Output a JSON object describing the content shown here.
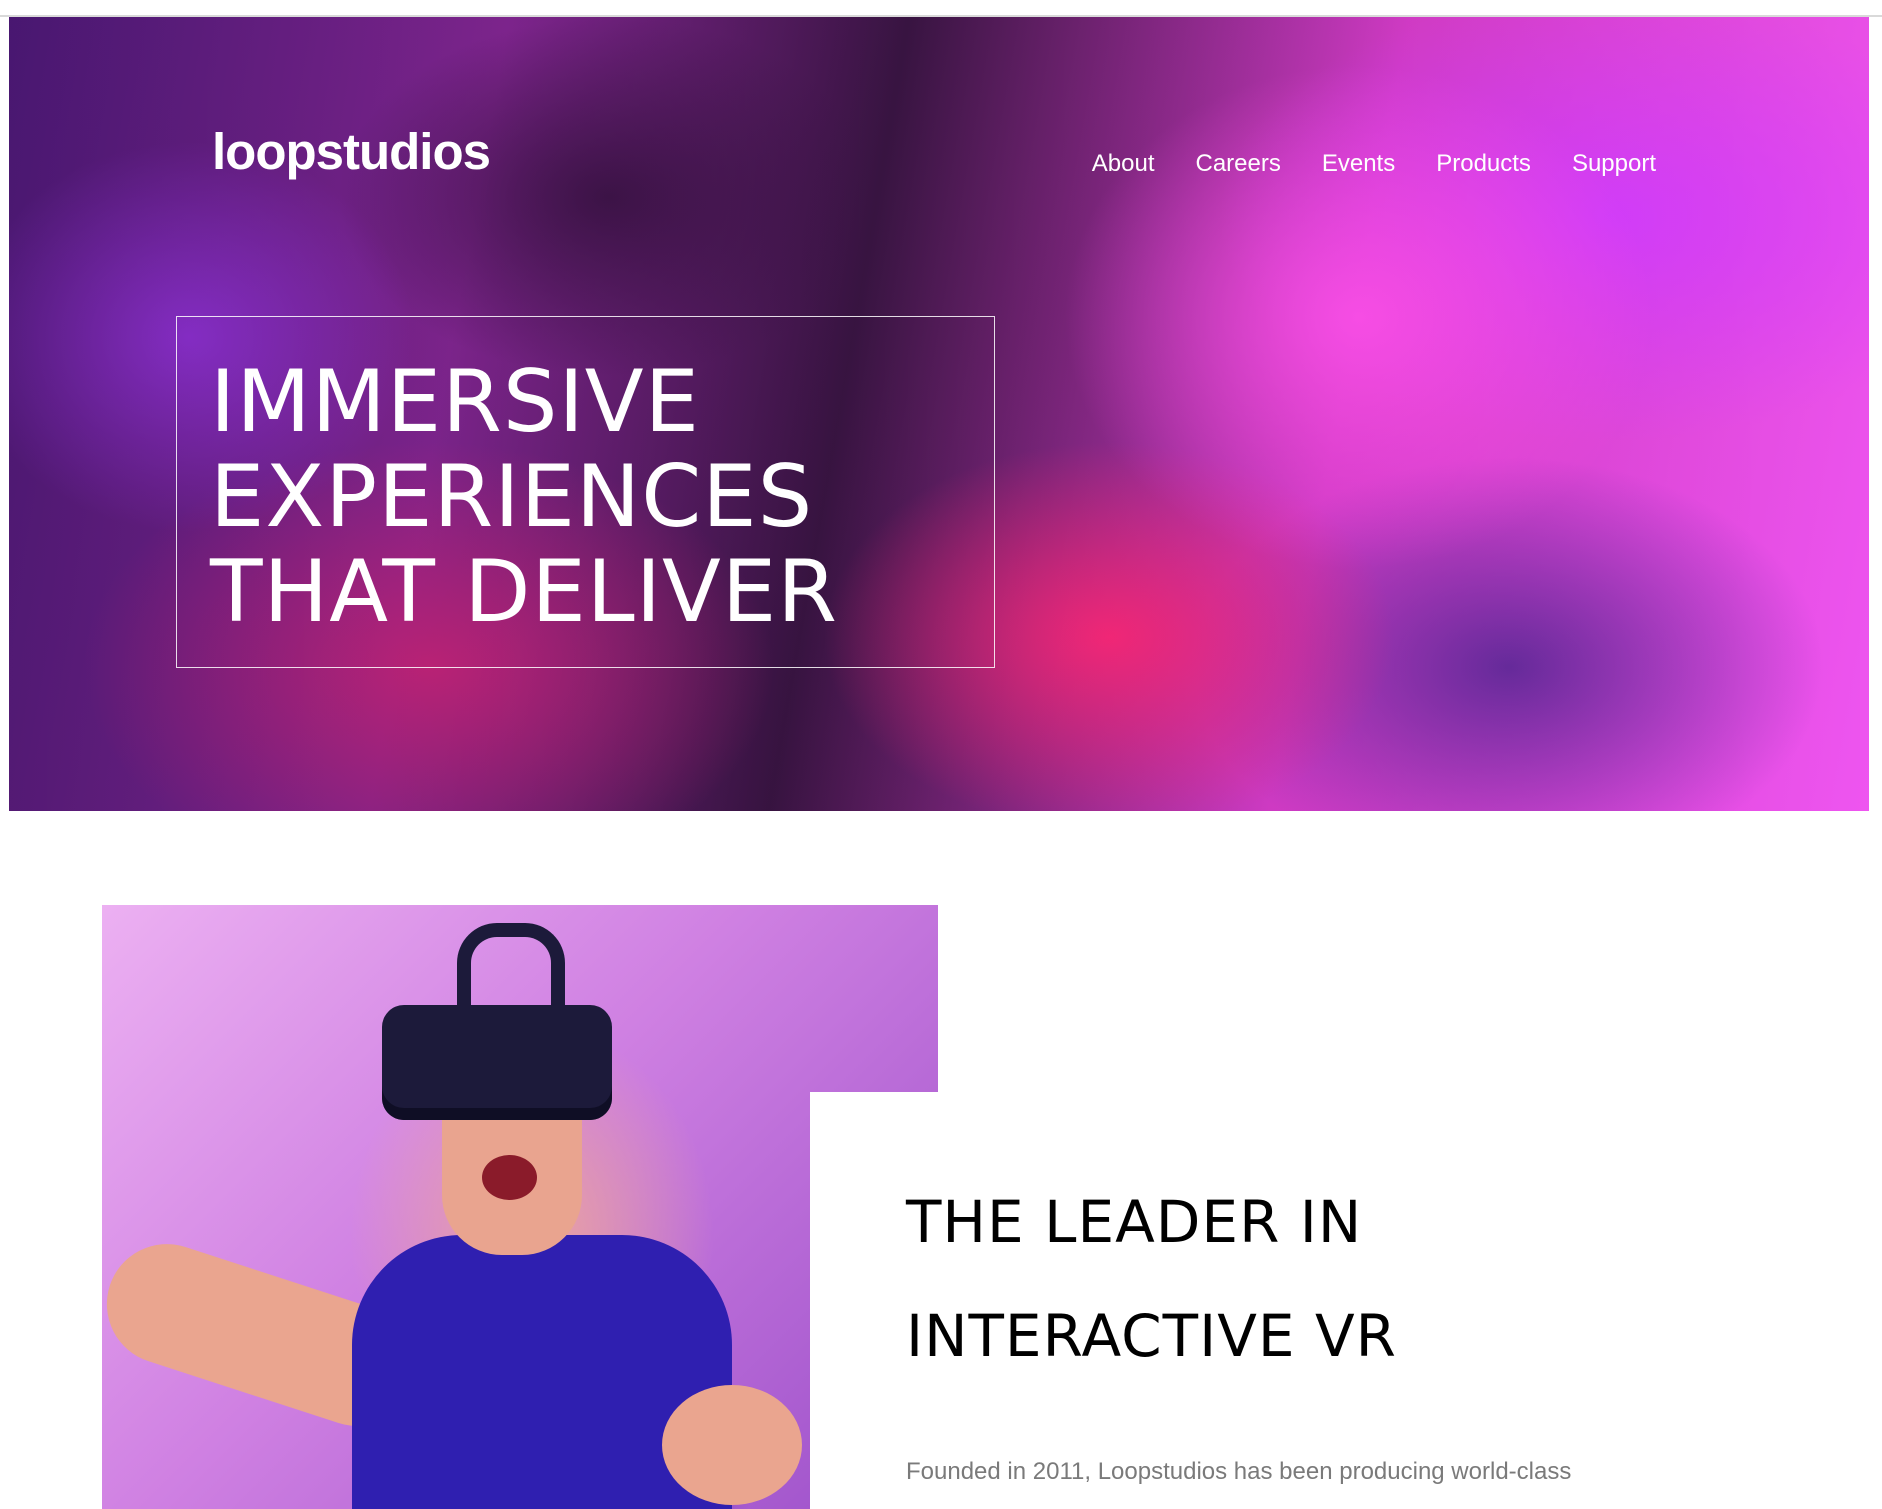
{
  "header": {
    "logo": "loopstudios",
    "nav": [
      "About",
      "Careers",
      "Events",
      "Products",
      "Support"
    ]
  },
  "hero": {
    "headline": [
      "IMMERSIVE",
      "EXPERIENCES",
      "THAT DELIVER"
    ]
  },
  "interactive": {
    "title": [
      "THE LEADER IN",
      "INTERACTIVE VR"
    ],
    "text": "Founded in 2011, Loopstudios has been producing world-class"
  },
  "colors": {
    "hero_overlay": "#1a0a24",
    "text_white": "#ffffff",
    "body_gray": "#7a7a7a",
    "title_black": "#000000"
  }
}
